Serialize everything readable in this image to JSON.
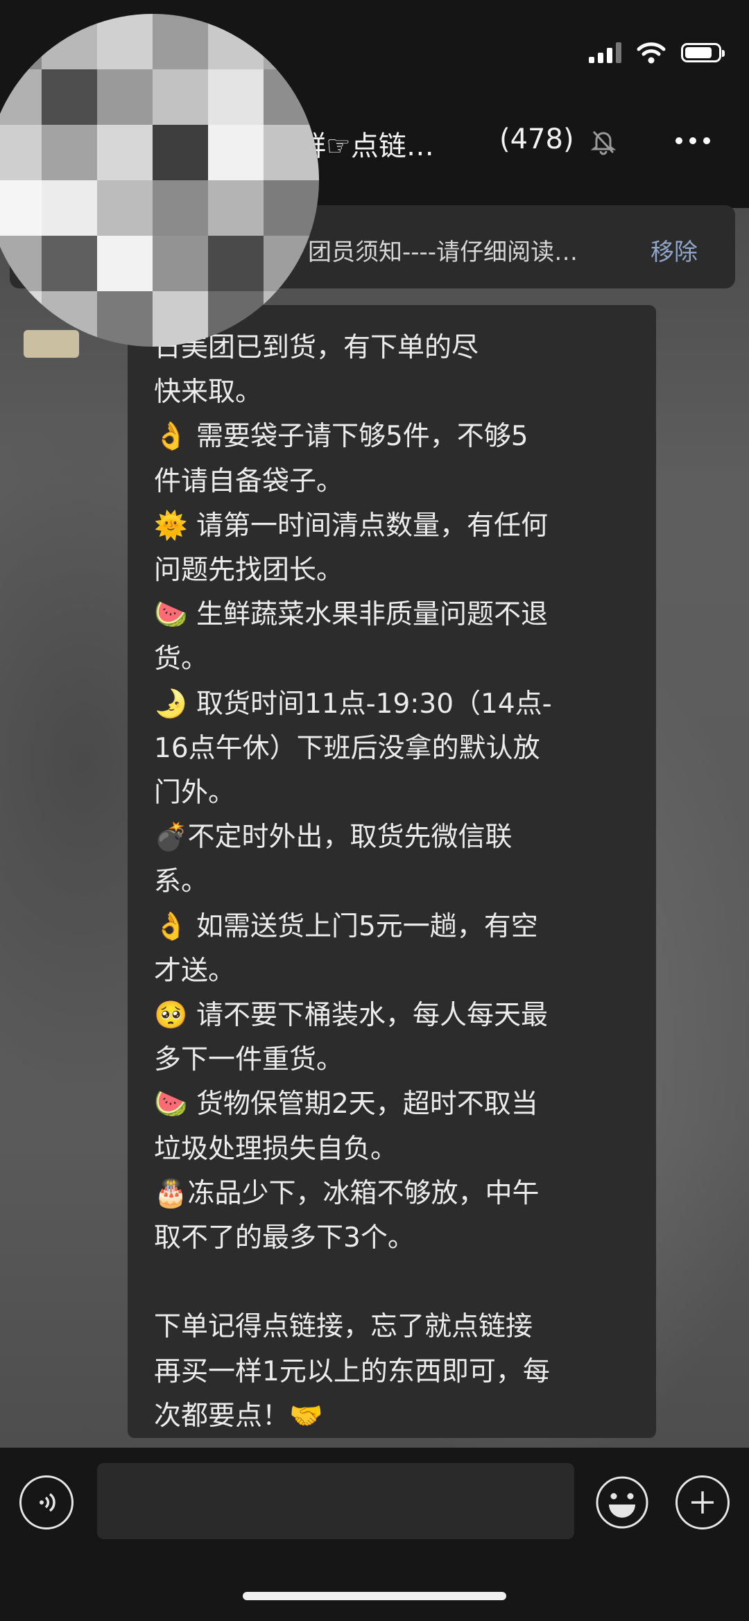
{
  "header": {
    "title": "群☞点链…",
    "member_count": "(478)",
    "mute_icon": "bell-slash-icon",
    "more_icon": "more-dots-icon"
  },
  "status_bar": {
    "signal_icon": "cellular-signal-icon",
    "wifi_icon": "wifi-icon",
    "battery_icon": "battery-icon"
  },
  "pinned": {
    "text": "团员须知----请仔细阅读…",
    "remove_label": "移除"
  },
  "message": {
    "text": "日美团已到货，有下单的尽\n快来取。\n👌 需要袋子请下够5件，不够5\n件请自备袋子。\n🌞 请第一时间清点数量，有任何\n问题先找团长。\n🍉 生鲜蔬菜水果非质量问题不退\n货。\n🌛 取货时间11点-19:30（14点-\n16点午休）下班后没拿的默认放\n门外。\n💣不定时外出，取货先微信联\n系。\n👌 如需送货上门5元一趟，有空\n才送。\n🥺 请不要下桶装水，每人每天最\n多下一件重货。\n🍉 货物保管期2天，超时不取当\n垃圾处理损失自负。\n🎂冻品少下，冰箱不够放，中午\n取不了的最多下3个。\n\n下单记得点链接，忘了就点链接\n再买一样1元以上的东西即可，每\n次都要点！🤝"
  },
  "input_bar": {
    "voice_icon": "voice-input-icon",
    "emoji_icon": "emoji-icon",
    "plus_icon": "plus-icon",
    "input_value": ""
  }
}
